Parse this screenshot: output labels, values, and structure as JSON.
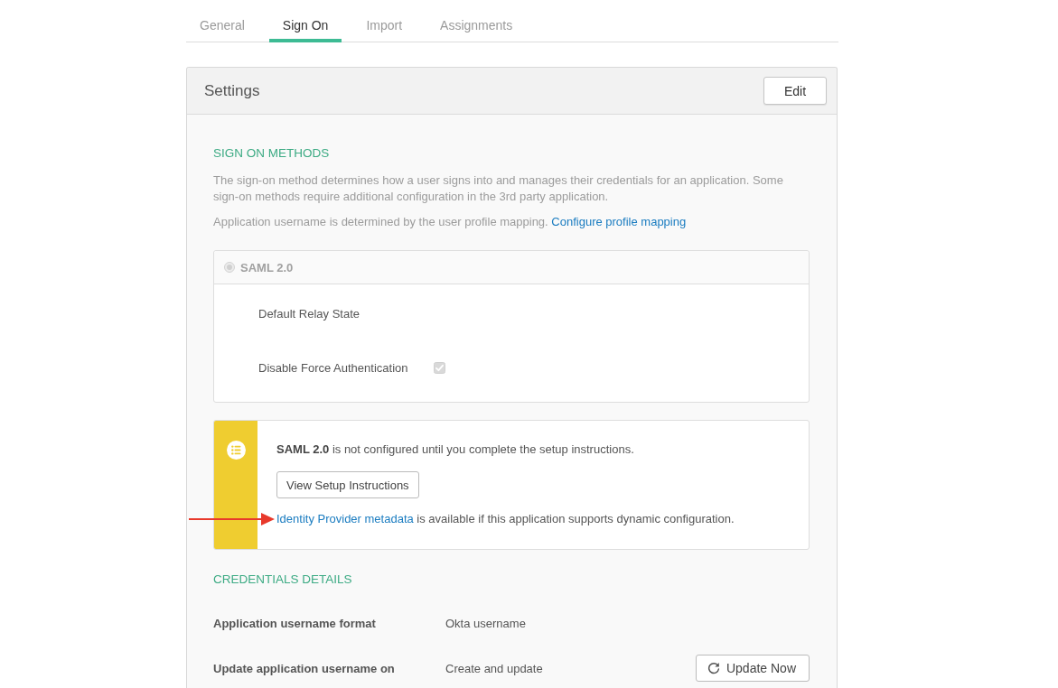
{
  "tabs": [
    {
      "label": "General",
      "selected": false
    },
    {
      "label": "Sign On",
      "selected": true
    },
    {
      "label": "Import",
      "selected": false
    },
    {
      "label": "Assignments",
      "selected": false
    }
  ],
  "settings": {
    "title": "Settings",
    "edit_button": "Edit"
  },
  "sign_on_methods": {
    "heading": "SIGN ON METHODS",
    "description": "The sign-on method determines how a user signs into and manages their credentials for an application. Some sign-on methods require additional configuration in the 3rd party application.",
    "mapping_note": "Application username is determined by the user profile mapping.",
    "mapping_link": "Configure profile mapping",
    "methods": [
      {
        "label": "SAML 2.0",
        "selected": true,
        "disabled": true,
        "fields": [
          {
            "kind": "text",
            "label": "Default Relay State"
          },
          {
            "kind": "checkbox",
            "label": "Disable Force Authentication",
            "checked": true,
            "disabled": true
          }
        ]
      }
    ]
  },
  "setup_notice": {
    "message": "**SAML 2.0** is not configured until you complete the setup instructions.",
    "button": "View Setup Instructions",
    "metadata_link": "Identity Provider metadata",
    "metadata_note": "is available if this application supports dynamic configuration.",
    "annotations": [
      {
        "kind": "arrow"
      }
    ]
  },
  "credentials_details": {
    "heading": "CREDENTIALS DETAILS",
    "rows": [
      {
        "label": "Application username format",
        "value": "Okta username"
      },
      {
        "label": "Update application username on",
        "value": "Create and update",
        "action": "Update Now"
      }
    ]
  }
}
